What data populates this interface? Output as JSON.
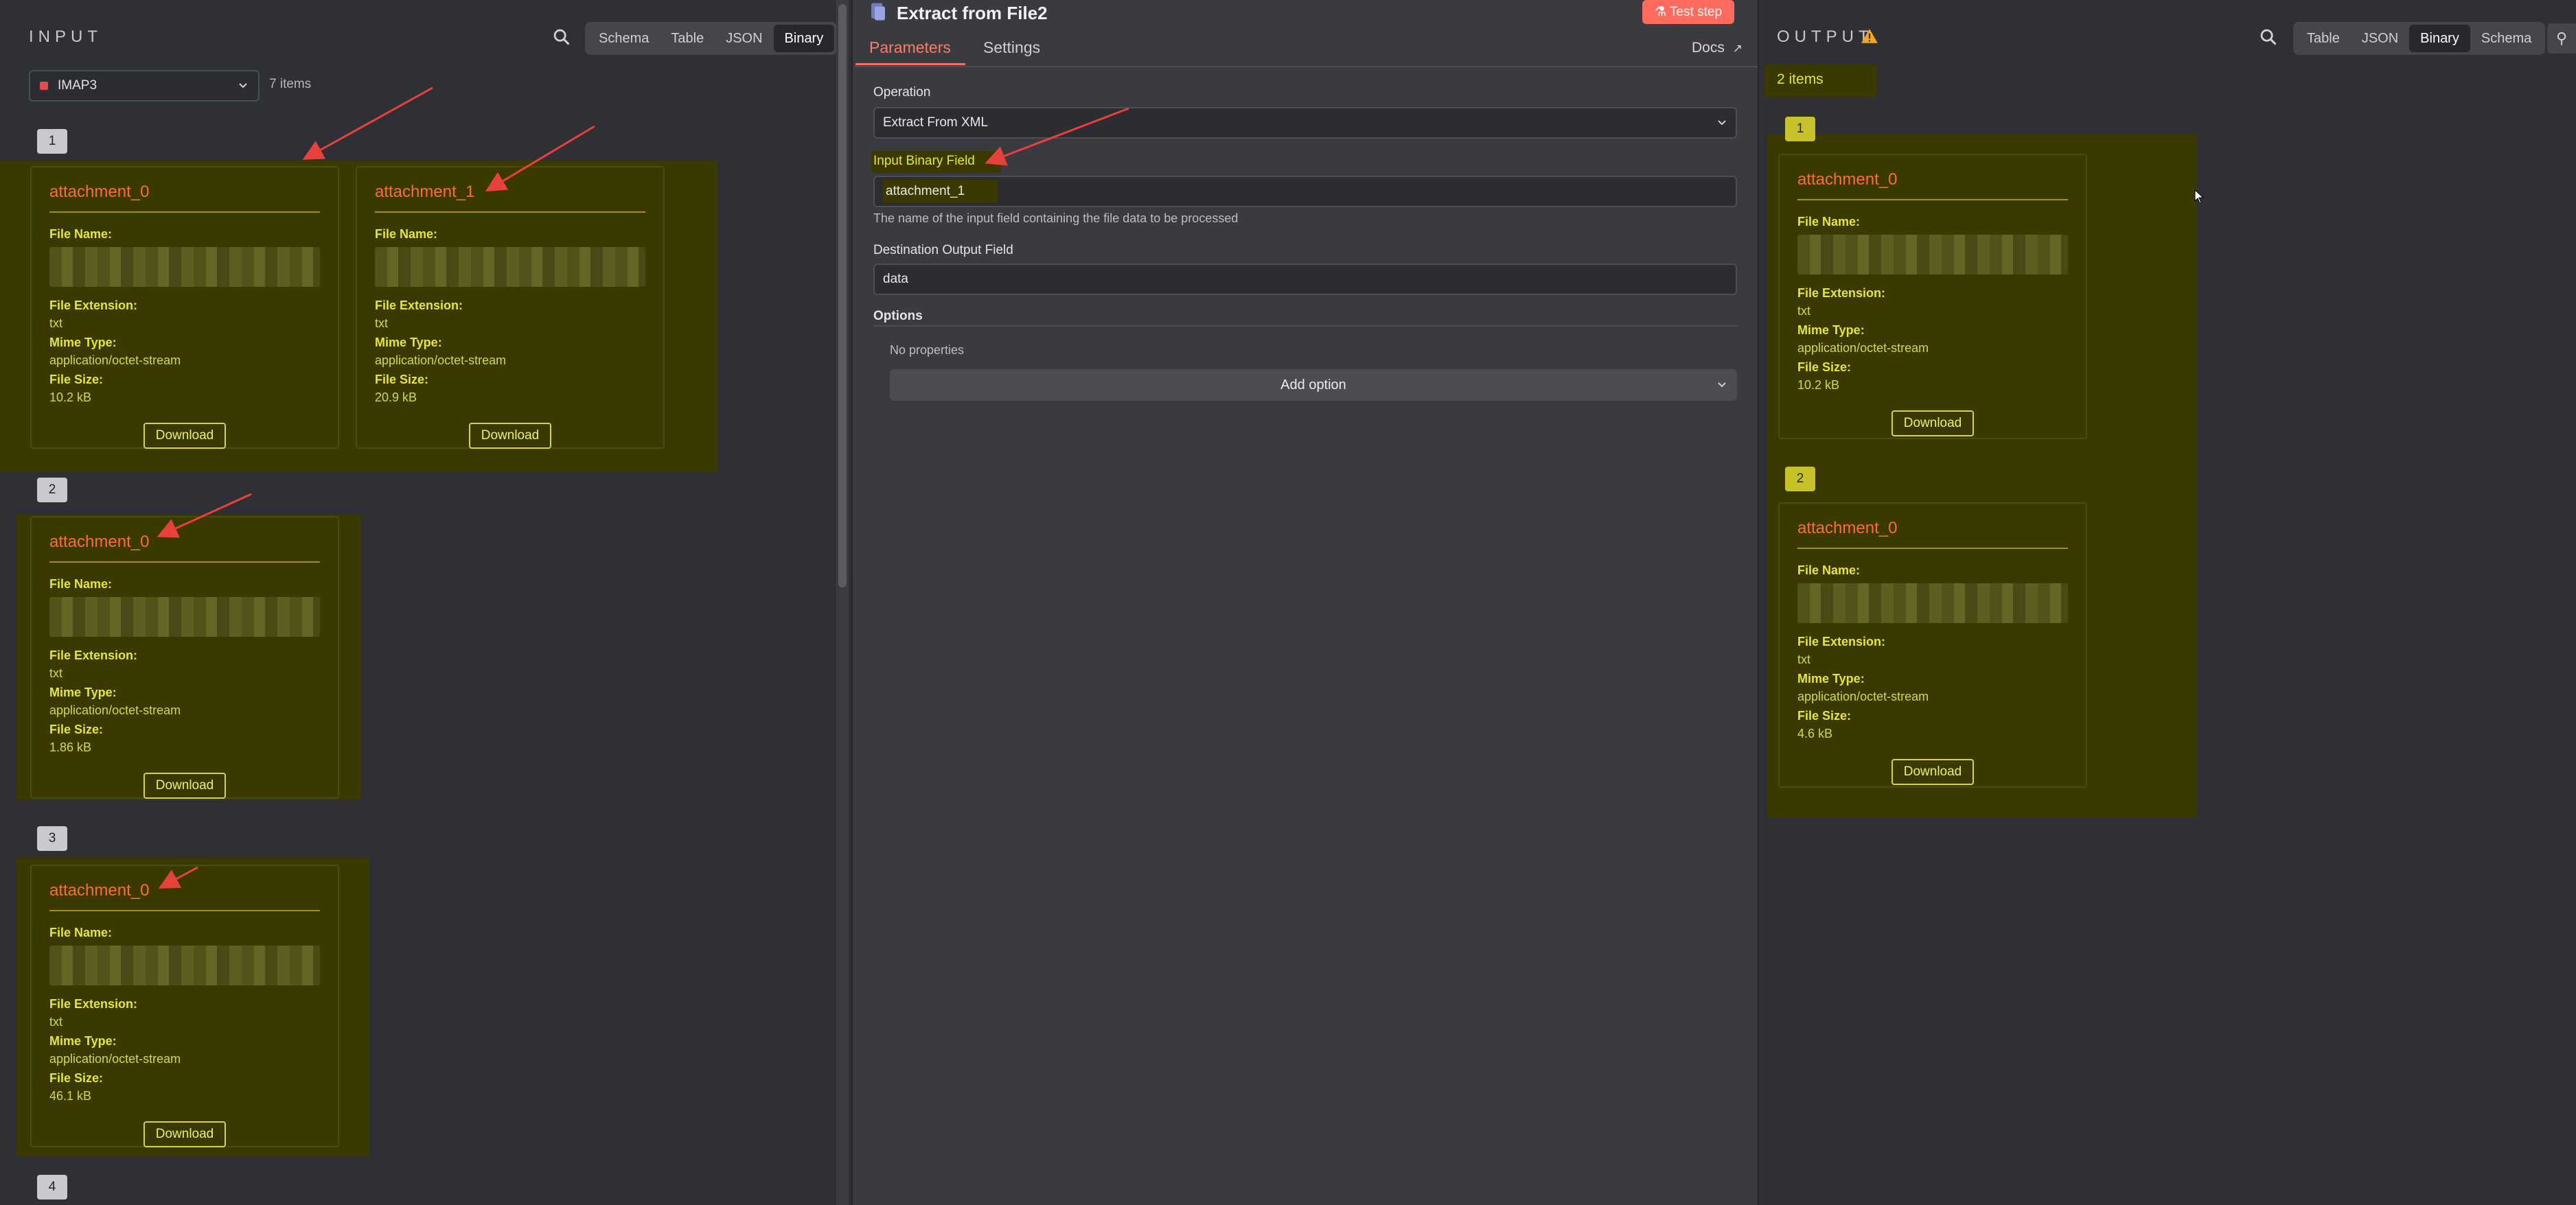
{
  "input": {
    "title": "INPUT",
    "tabs": [
      "Schema",
      "Table",
      "JSON",
      "Binary"
    ],
    "active_tab": "Binary",
    "source_select": "IMAP3",
    "items_count": "7 items",
    "groups": [
      {
        "index": "1",
        "cards": [
          {
            "title": "attachment_0",
            "file_name_label": "File Name:",
            "ext_label": "File Extension:",
            "ext": "txt",
            "mime_label": "Mime Type:",
            "mime": "application/octet-stream",
            "size_label": "File Size:",
            "size": "10.2 kB",
            "download": "Download"
          },
          {
            "title": "attachment_1",
            "file_name_label": "File Name:",
            "ext_label": "File Extension:",
            "ext": "txt",
            "mime_label": "Mime Type:",
            "mime": "application/octet-stream",
            "size_label": "File Size:",
            "size": "20.9 kB",
            "download": "Download"
          }
        ]
      },
      {
        "index": "2",
        "cards": [
          {
            "title": "attachment_0",
            "file_name_label": "File Name:",
            "ext_label": "File Extension:",
            "ext": "txt",
            "mime_label": "Mime Type:",
            "mime": "application/octet-stream",
            "size_label": "File Size:",
            "size": "1.86 kB",
            "download": "Download"
          }
        ]
      },
      {
        "index": "3",
        "cards": [
          {
            "title": "attachment_0",
            "file_name_label": "File Name:",
            "ext_label": "File Extension:",
            "ext": "txt",
            "mime_label": "Mime Type:",
            "mime": "application/octet-stream",
            "size_label": "File Size:",
            "size": "46.1 kB",
            "download": "Download"
          }
        ]
      },
      {
        "index": "4",
        "cards": []
      }
    ]
  },
  "node": {
    "title": "Extract from File2",
    "test_button": "Test step",
    "tabs": [
      "Parameters",
      "Settings"
    ],
    "active_tab": "Parameters",
    "docs": "Docs",
    "operation_label": "Operation",
    "operation_value": "Extract From XML",
    "input_binary_label": "Input Binary Field",
    "input_binary_value": "attachment_1",
    "input_binary_hint": "The name of the input field containing the file data to be processed",
    "dest_label": "Destination Output Field",
    "dest_value": "data",
    "options_label": "Options",
    "no_props": "No properties",
    "add_option": "Add option"
  },
  "output": {
    "title": "OUTPUT",
    "tabs": [
      "Table",
      "JSON",
      "Binary",
      "Schema"
    ],
    "active_tab": "Binary",
    "items_count": "2 items",
    "groups": [
      {
        "index": "1",
        "card": {
          "title": "attachment_0",
          "file_name_label": "File Name:",
          "ext_label": "File Extension:",
          "ext": "txt",
          "mime_label": "Mime Type:",
          "mime": "application/octet-stream",
          "size_label": "File Size:",
          "size": "10.2 kB",
          "download": "Download"
        }
      },
      {
        "index": "2",
        "card": {
          "title": "attachment_0",
          "file_name_label": "File Name:",
          "ext_label": "File Extension:",
          "ext": "txt",
          "mime_label": "Mime Type:",
          "mime": "application/octet-stream",
          "size_label": "File Size:",
          "size": "4.6 kB",
          "download": "Download"
        }
      }
    ]
  },
  "colors": {
    "accent": "#ff6b5e",
    "title_orange": "#ff6d2d",
    "highlight": "#3a3a00"
  }
}
